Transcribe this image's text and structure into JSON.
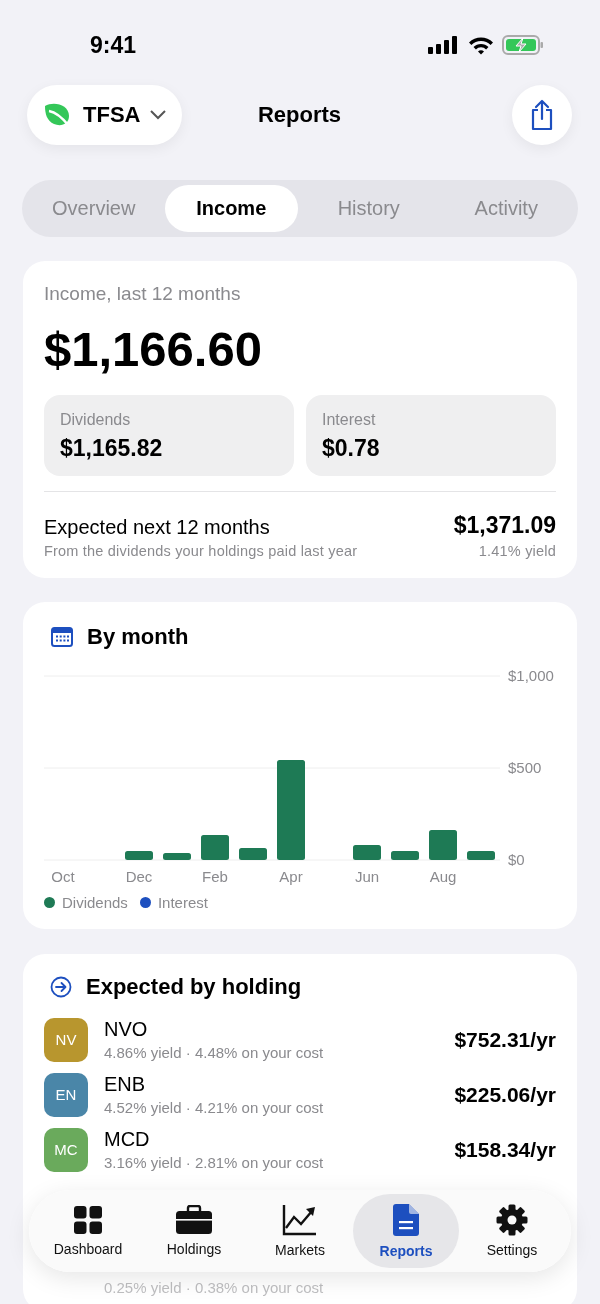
{
  "status_bar": {
    "time": "9:41"
  },
  "header": {
    "account": "TFSA",
    "title": "Reports"
  },
  "tabs": [
    {
      "label": "Overview",
      "selected": false
    },
    {
      "label": "Income",
      "selected": true
    },
    {
      "label": "History",
      "selected": false
    },
    {
      "label": "Activity",
      "selected": false
    }
  ],
  "summary": {
    "label": "Income, last 12 months",
    "total": "$1,166.60",
    "breakdown": [
      {
        "label": "Dividends",
        "value": "$1,165.82"
      },
      {
        "label": "Interest",
        "value": "$0.78"
      }
    ],
    "expected": {
      "title": "Expected next 12 months",
      "subtitle": "From the dividends your holdings paid last year",
      "value": "$1,371.09",
      "yield": "1.41% yield"
    }
  },
  "by_month": {
    "title": "By month",
    "chart_data": {
      "type": "bar",
      "categories": [
        "Oct",
        null,
        "Dec",
        null,
        "Feb",
        null,
        "Apr",
        null,
        "Jun",
        null,
        "Aug",
        null
      ],
      "ylim": [
        0,
        1000
      ],
      "yticks": [
        {
          "value": 0,
          "label": "$0"
        },
        {
          "value": 500,
          "label": "$500"
        },
        {
          "value": 1000,
          "label": "$1,000"
        }
      ],
      "stacked": true,
      "series": [
        {
          "name": "Dividends",
          "color": "#1e7a55",
          "values": [
            0,
            0,
            49,
            38,
            136,
            65,
            543,
            0,
            82,
            49,
            163,
            49
          ]
        },
        {
          "name": "Interest",
          "color": "#1d4fbf",
          "values": [
            0,
            0,
            0,
            0,
            0,
            0,
            0,
            0,
            0,
            0,
            0,
            0
          ]
        }
      ]
    }
  },
  "holdings": {
    "title": "Expected by holding",
    "items": [
      {
        "badge": "NV",
        "color": "#b8962e",
        "ticker": "NVO",
        "detail": "4.86% yield · 4.48% on your cost",
        "amount": "$752.31/yr"
      },
      {
        "badge": "EN",
        "color": "#4a86a8",
        "ticker": "ENB",
        "detail": "4.52% yield · 4.21% on your cost",
        "amount": "$225.06/yr"
      },
      {
        "badge": "MC",
        "color": "#6aaa5c",
        "ticker": "MCD",
        "detail": "3.16% yield · 2.81% on your cost",
        "amount": "$158.34/yr"
      }
    ],
    "partial_detail": "0.25% yield · 0.38% on your cost"
  },
  "tab_bar": [
    {
      "label": "Dashboard",
      "selected": false
    },
    {
      "label": "Holdings",
      "selected": false
    },
    {
      "label": "Markets",
      "selected": false
    },
    {
      "label": "Reports",
      "selected": true
    },
    {
      "label": "Settings",
      "selected": false
    }
  ]
}
